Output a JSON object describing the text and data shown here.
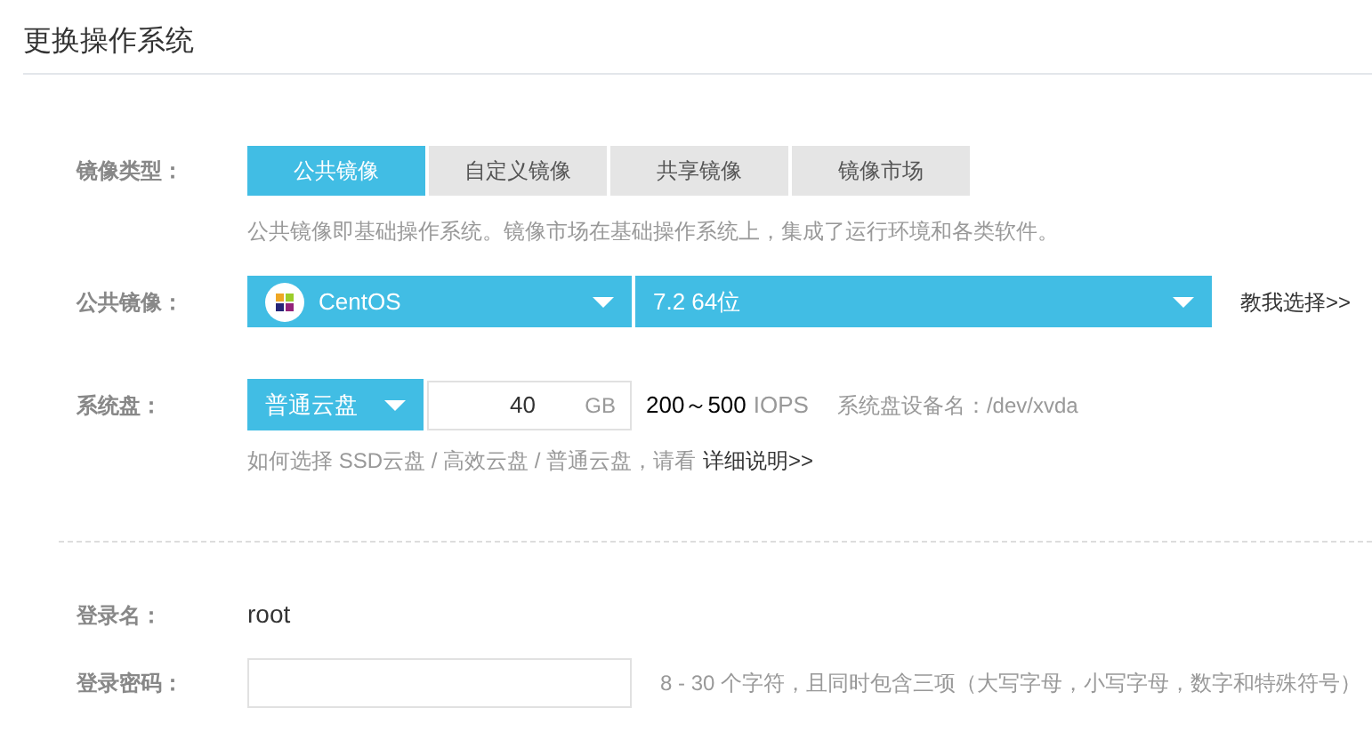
{
  "title": "更换操作系统",
  "image_type": {
    "label": "镜像类型：",
    "tabs": [
      {
        "label": "公共镜像",
        "selected": true
      },
      {
        "label": "自定义镜像",
        "selected": false
      },
      {
        "label": "共享镜像",
        "selected": false
      },
      {
        "label": "镜像市场",
        "selected": false
      }
    ],
    "description": "公共镜像即基础操作系统。镜像市场在基础操作系统上，集成了运行环境和各类软件。"
  },
  "public_image": {
    "label": "公共镜像：",
    "os": "CentOS",
    "version": "7.2 64位",
    "help_link": "教我选择>>"
  },
  "system_disk": {
    "label": "系统盘：",
    "disk_type": "普通云盘",
    "size": "40",
    "unit": "GB",
    "iops_range": "200～500",
    "iops_unit": "IOPS",
    "device_name": "系统盘设备名：/dev/xvda",
    "hint": "如何选择 SSD云盘 / 高效云盘 / 普通云盘，请看",
    "hint_link": "详细说明>>"
  },
  "login": {
    "label": "登录名：",
    "value": "root"
  },
  "password": {
    "label": "登录密码：",
    "hint": "8 - 30 个字符，且同时包含三项（大写字母，小写字母，数字和特殊符号）"
  }
}
